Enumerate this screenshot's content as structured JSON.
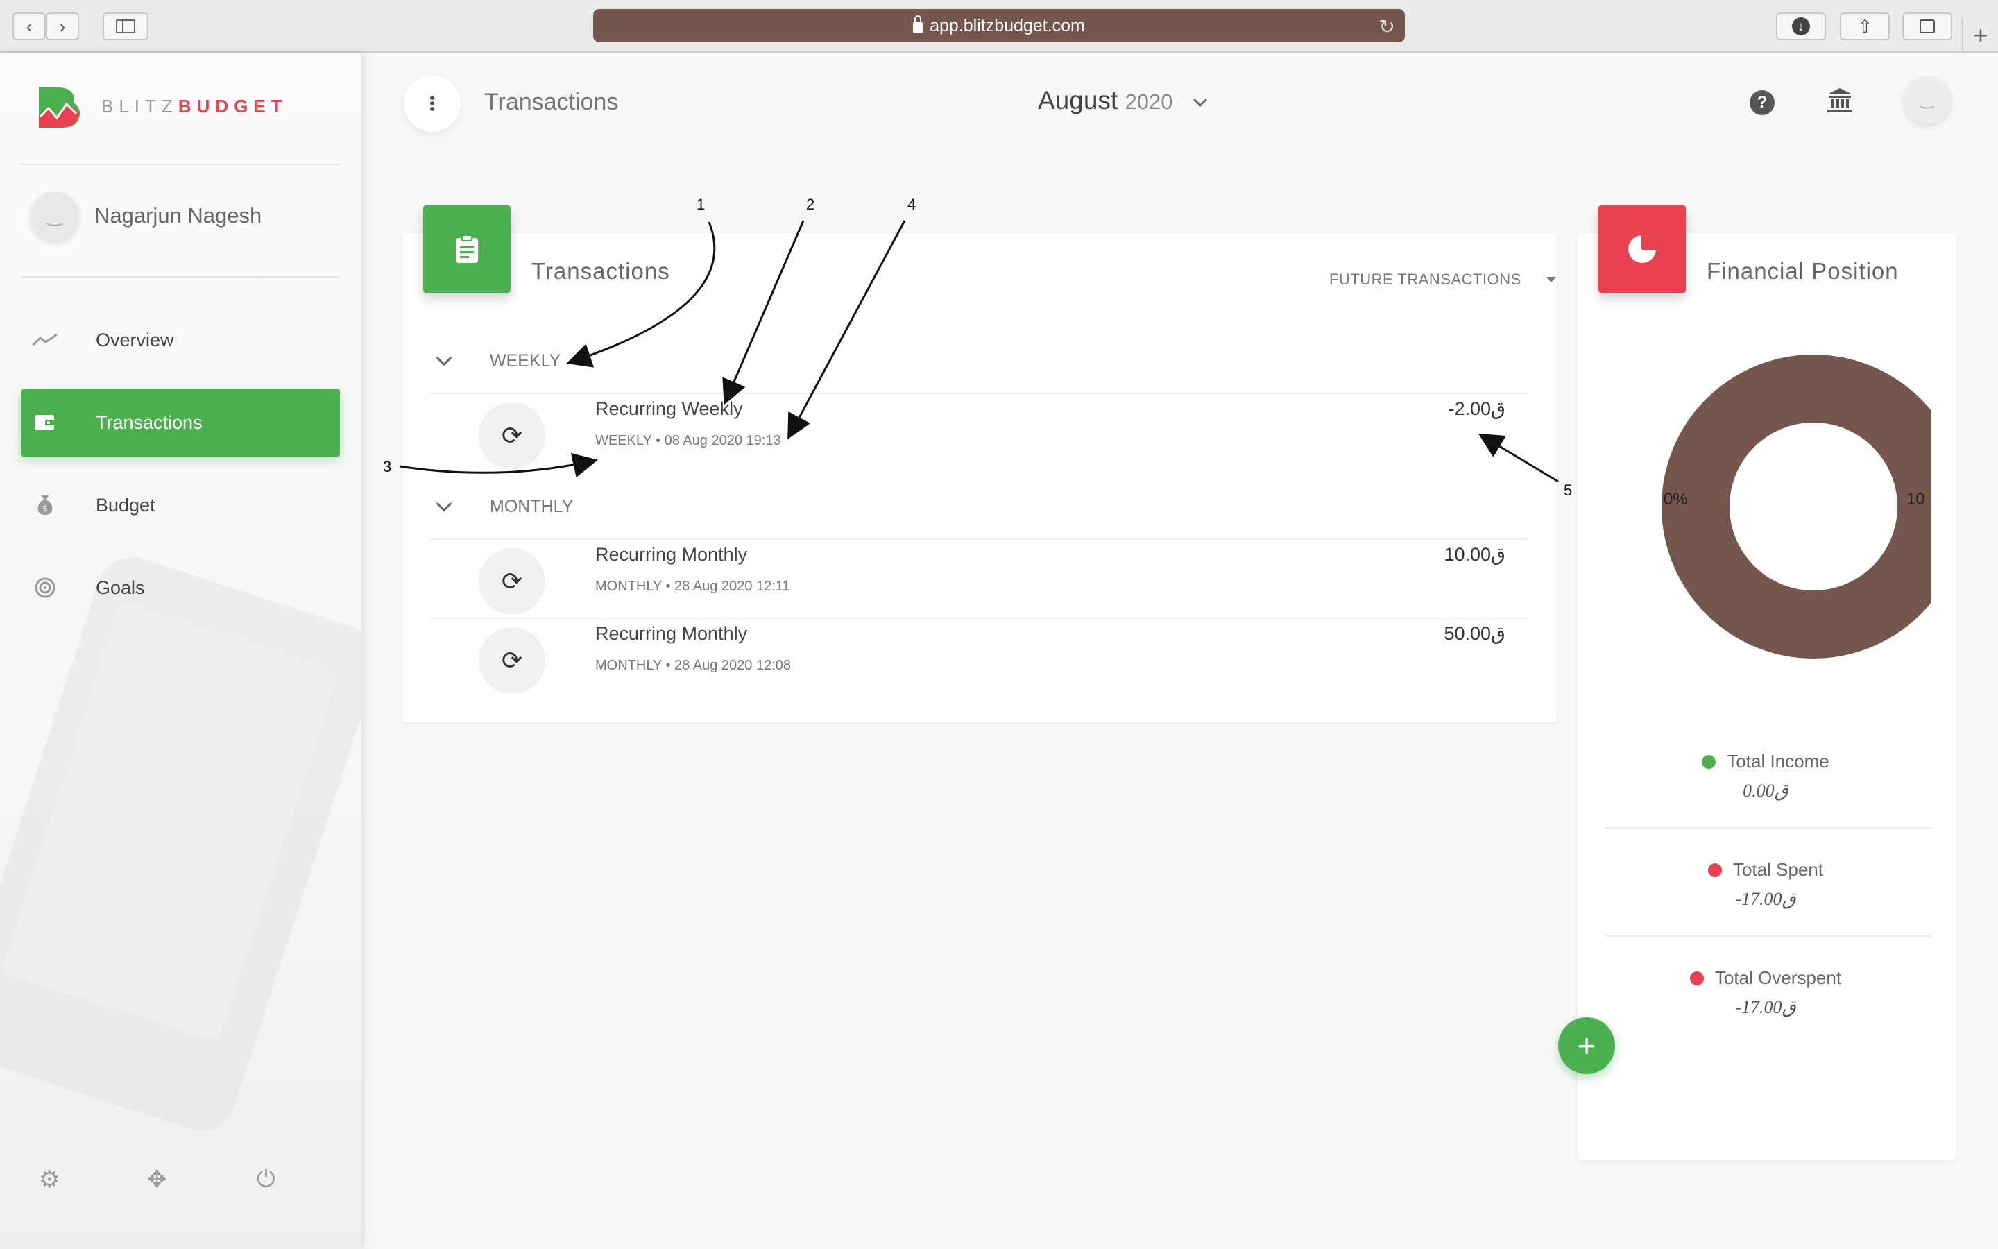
{
  "browser": {
    "url": "app.blitzbudget.com"
  },
  "brand": {
    "light": "BLITZ",
    "bold": "BUDGET",
    "accent": "#e8414f",
    "green": "#4caf50"
  },
  "profile": {
    "name": "Nagarjun Nagesh"
  },
  "sidebar": {
    "items": [
      {
        "label": "Overview",
        "icon": "trend-icon"
      },
      {
        "label": "Transactions",
        "icon": "wallet-icon",
        "active": true
      },
      {
        "label": "Budget",
        "icon": "money-bag-icon"
      },
      {
        "label": "Goals",
        "icon": "target-icon"
      }
    ]
  },
  "topbar": {
    "title": "Transactions",
    "month": "August",
    "year": "2020"
  },
  "transactions": {
    "title": "Transactions",
    "filter": "FUTURE TRANSACTIONS",
    "groups": [
      {
        "label": "WEEKLY",
        "rows": [
          {
            "name": "Recurring Weekly",
            "meta": "WEEKLY • 08 Aug 2020 19:13",
            "amount": "-2.00ق"
          }
        ]
      },
      {
        "label": "MONTHLY",
        "rows": [
          {
            "name": "Recurring Monthly",
            "meta": "MONTHLY • 28 Aug 2020 12:11",
            "amount": "10.00ق"
          },
          {
            "name": "Recurring Monthly",
            "meta": "MONTHLY • 28 Aug 2020 12:08",
            "amount": "50.00ق"
          }
        ]
      }
    ]
  },
  "financial": {
    "title": "Financial Position",
    "donut_color": "#74564c",
    "pct_left": "0%",
    "pct_right": "10",
    "legend": [
      {
        "label": "Total Income",
        "value": "0.00ق",
        "color": "#4caf50"
      },
      {
        "label": "Total Spent",
        "value": "-17.00ق",
        "color": "#e8414f"
      },
      {
        "label": "Total Overspent",
        "value": "-17.00ق",
        "color": "#e8414f"
      }
    ]
  },
  "annotations": [
    "1",
    "2",
    "3",
    "4",
    "5"
  ]
}
